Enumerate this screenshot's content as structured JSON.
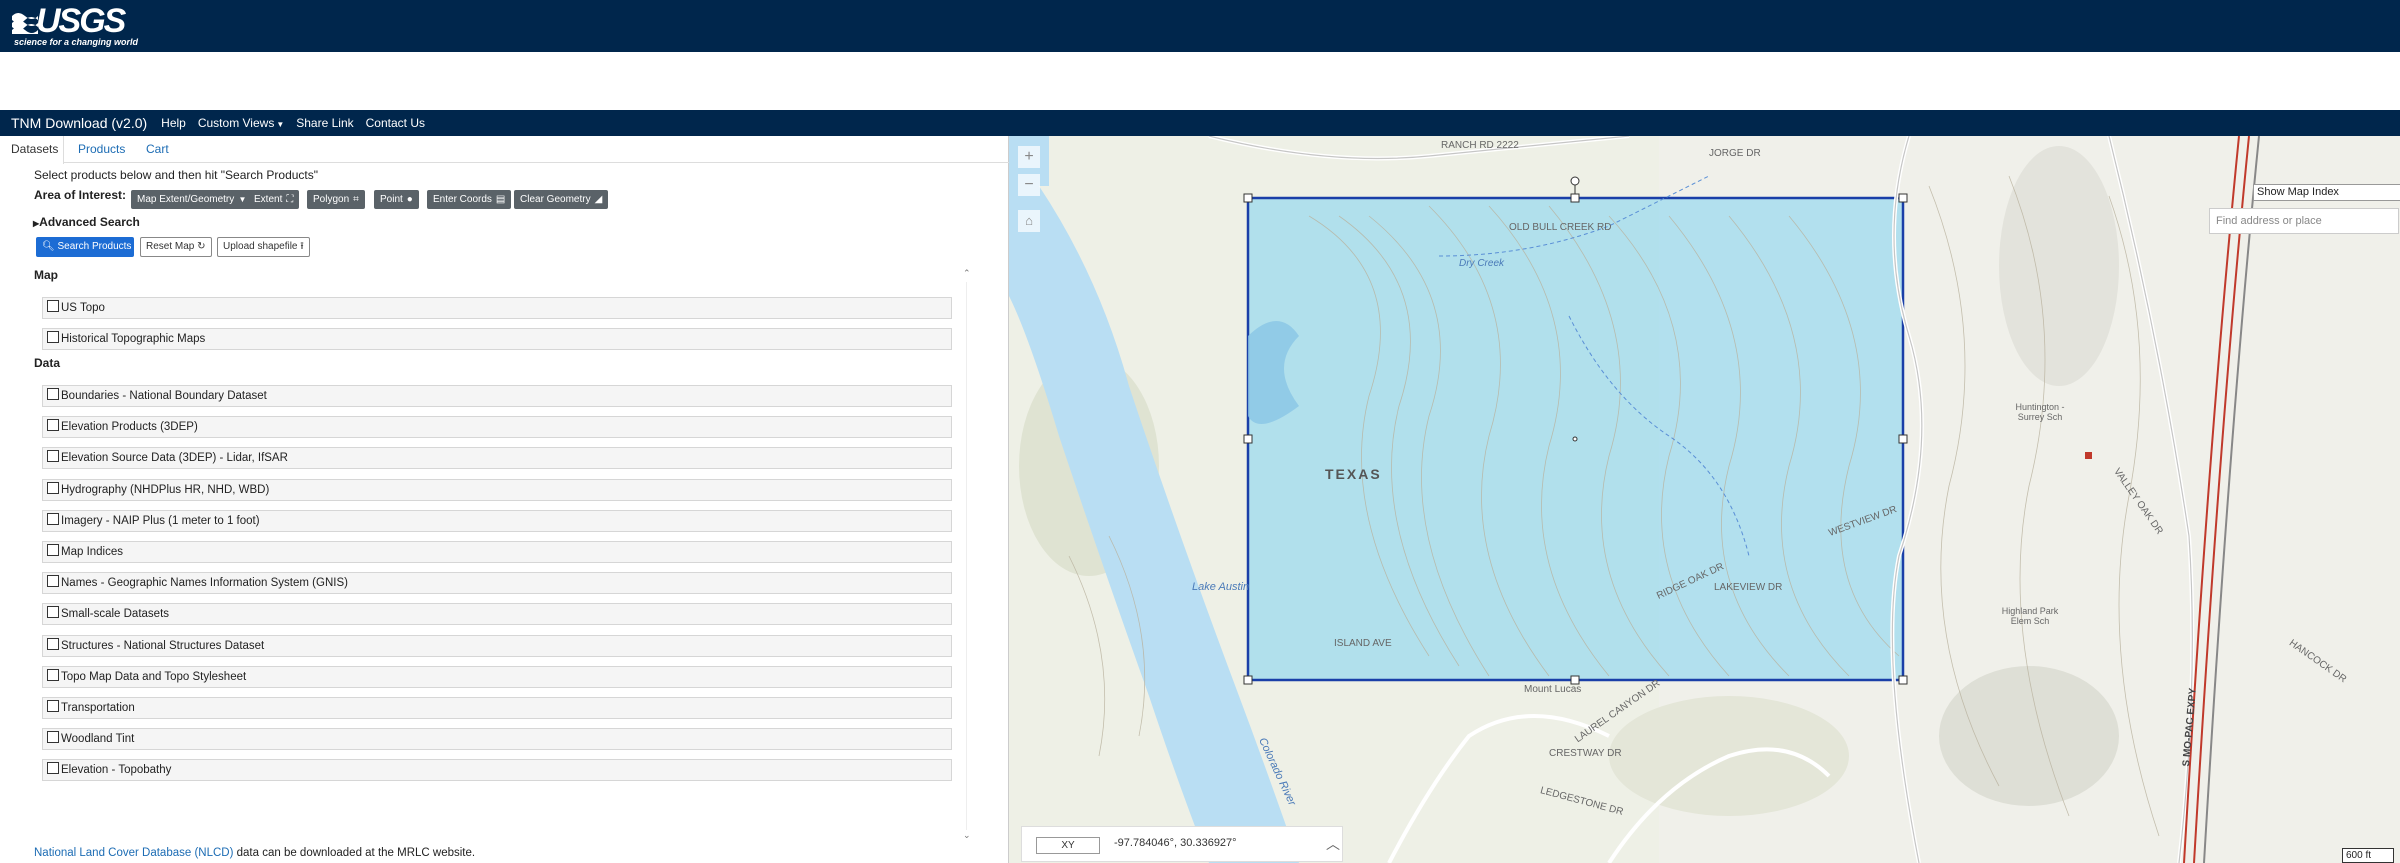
{
  "header": {
    "logo_text": "USGS",
    "tagline": "science for a changing world"
  },
  "nav": {
    "title": "TNM Download (v2.0)",
    "items": [
      "Help",
      "Custom Views",
      "Share Link",
      "Contact Us"
    ]
  },
  "tabs": [
    "Datasets",
    "Products",
    "Cart"
  ],
  "panel": {
    "instructions": "Select products below and then hit \"Search Products\"",
    "aoi_label": "Area of Interest:",
    "aoi_buttons": [
      "Map Extent/Geometry",
      "Extent",
      "Polygon",
      "Point",
      "Enter Coords",
      "Clear Geometry"
    ],
    "advanced_search": "Advanced Search",
    "search_button": "Search Products",
    "reset_map": "Reset Map",
    "upload_shapefile": "Upload shapefile"
  },
  "sections": {
    "map": "Map",
    "data": "Data"
  },
  "map_products": [
    "US Topo",
    "Historical Topographic Maps"
  ],
  "data_products": [
    "Boundaries - National Boundary Dataset",
    "Elevation Products (3DEP)",
    "Elevation Source Data (3DEP) - Lidar, IfSAR",
    "Hydrography (NHDPlus HR, NHD, WBD)",
    "Imagery - NAIP Plus (1 meter to 1 foot)",
    "Map Indices",
    "Names - Geographic Names Information System (GNIS)",
    "Small-scale Datasets",
    "Structures - National Structures Dataset",
    "Topo Map Data and Topo Stylesheet",
    "Transportation",
    "Woodland Tint",
    "Elevation - Topobathy"
  ],
  "footer_note": {
    "link": "National Land Cover Database (NLCD)",
    "text": " data can be downloaded at the MRLC website."
  },
  "map": {
    "show_map_index": "Show Map Index",
    "search_placeholder": "Find address or place",
    "coord_system": "XY",
    "coordinates": "-97.784046°, 30.336927°",
    "scale": "600 ft",
    "labels": {
      "texas": "TEXAS",
      "lake_austin": "Lake Austin",
      "colorado_river": "Colorado River",
      "mount_lucas": "Mount Lucas",
      "huntington": "Huntington - Surrey Sch",
      "highland_park": "Highland Park Elem Sch",
      "ranch_rd": "RANCH RD 2222",
      "jorge_dr": "JORGE DR",
      "old_bull_creek": "OLD BULL CREEK RD",
      "dry_creek": "Dry Creek",
      "ridge_oak": "RIDGE OAK DR",
      "lakeview": "LAKEVIEW DR",
      "westview": "WESTVIEW DR",
      "island_ave": "ISLAND AVE",
      "valley_oak": "VALLEY OAK DR",
      "s_mopac": "S MO-PAC EXPY",
      "hancock": "HANCOCK DR",
      "laurel_canyon": "LAUREL CANYON DR",
      "crestway": "CRESTWAY DR",
      "ledgestone": "LEDGESTONE DR"
    },
    "accent": "#1a3fa8",
    "aoi_fill": "#7fd3f0"
  }
}
